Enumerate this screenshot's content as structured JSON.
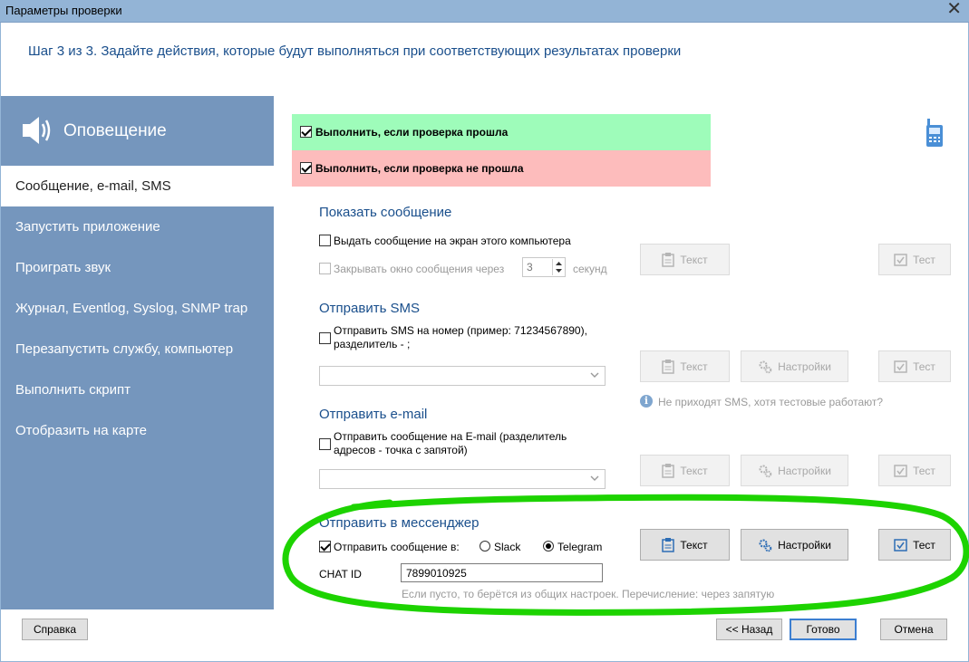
{
  "window": {
    "title": "Параметры проверки",
    "close_glyph": "✕"
  },
  "step_text": "Шаг 3 из 3. Задайте действия, которые будут выполняться при соответствующих результатах проверки",
  "sidebar": {
    "title": "Оповещение",
    "items": [
      {
        "label": "Сообщение, e-mail, SMS",
        "active": true
      },
      {
        "label": "Запустить приложение"
      },
      {
        "label": "Проиграть звук"
      },
      {
        "label": "Журнал, Eventlog, Syslog, SNMP trap"
      },
      {
        "label": "Перезапустить службу, компьютер"
      },
      {
        "label": "Выполнить скрипт"
      },
      {
        "label": "Отобразить на карте"
      }
    ]
  },
  "conditions": {
    "on_success": "Выполнить, если проверка прошла",
    "on_failure": "Выполнить, если проверка не прошла"
  },
  "show_message": {
    "title": "Показать сообщение",
    "checkbox": "Выдать сообщение на экран этого компьютера",
    "close_label": "Закрывать окно сообщения через",
    "close_value": "3",
    "close_unit": "секунд",
    "text_btn": "Текст",
    "test_btn": "Тест"
  },
  "sms": {
    "title": "Отправить SMS",
    "checkbox": "Отправить SMS на номер (пример: 71234567890), разделитель - ;",
    "text_btn": "Текст",
    "settings_btn": "Настройки",
    "test_btn": "Тест",
    "hint": "Не приходят SMS, хотя тестовые работают?"
  },
  "email": {
    "title": "Отправить e-mail",
    "checkbox": "Отправить сообщение на E-mail (разделитель адресов - точка с запятой)",
    "text_btn": "Текст",
    "settings_btn": "Настройки",
    "test_btn": "Тест"
  },
  "messenger": {
    "title": "Отправить в мессенджер",
    "checkbox": "Отправить сообщение в:",
    "options": [
      "Slack",
      "Telegram"
    ],
    "selected": "Telegram",
    "chat_label": "CHAT ID",
    "chat_value": "7899010925",
    "chat_hint": "Если пусто, то берётся из общих настроек. Перечисление: через запятую",
    "text_btn": "Текст",
    "settings_btn": "Настройки",
    "test_btn": "Тест"
  },
  "footer": {
    "help": "Справка",
    "back": "<< Назад",
    "done": "Готово",
    "cancel": "Отмена"
  },
  "colors": {
    "accent": "#1a4f8c",
    "sidebar": "#7596bd",
    "success_row": "#9efcba",
    "failure_row": "#fdbcbc",
    "highlight": "#1dd300"
  }
}
